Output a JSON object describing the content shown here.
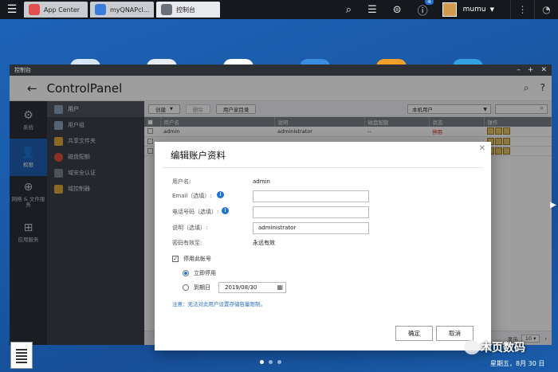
{
  "taskbar": {
    "tabs": [
      {
        "label": "App Center",
        "color": "#e34f4f"
      },
      {
        "label": "myQNAPcl...",
        "color": "#3a7dd8"
      },
      {
        "label": "控制台",
        "color": "#6b7078"
      }
    ],
    "notification_count": "4",
    "username": "mumu"
  },
  "controlpanel": {
    "window_title": "控制台",
    "title": "ControlPanel",
    "rail": [
      {
        "label": "系统",
        "icon": "gear-icon"
      },
      {
        "label": "权限",
        "icon": "user-icon"
      },
      {
        "label": "网络 & 文件服务",
        "icon": "globe-icon"
      },
      {
        "label": "应用服务",
        "icon": "apps-icon"
      }
    ],
    "subnav": [
      {
        "label": "用户",
        "color": "#8ea0b8"
      },
      {
        "label": "用户组",
        "color": "#8ea0b8"
      },
      {
        "label": "共享文件夹",
        "color": "#e0a83a"
      },
      {
        "label": "磁盘配额",
        "color": "#e04e3a"
      },
      {
        "label": "域安全认证",
        "color": "#7d8794"
      },
      {
        "label": "域控制器",
        "color": "#e0a83a"
      }
    ],
    "toolbar": {
      "create": "创建",
      "delete": "删除",
      "home": "用户家目录",
      "filter": "本机用户"
    },
    "table": {
      "headers": [
        "用户名",
        "说明",
        "磁盘配额",
        "状态",
        "操作"
      ],
      "rows": [
        {
          "name": "admin",
          "desc": "administrator",
          "quota": "--",
          "status": "停用"
        }
      ]
    },
    "pager": {
      "label": "显示",
      "size": "10"
    }
  },
  "dialog": {
    "title": "编辑账户资料",
    "username_label": "用户名:",
    "username_value": "admin",
    "email_label": "Email（选填）:",
    "email_value": "",
    "phone_label": "电话号码（选填）:",
    "phone_value": "",
    "desc_label": "说明（选填）:",
    "desc_value": "administrator",
    "pw_label": "密码有效至:",
    "pw_value": "永远有效",
    "disable_label": "停用此帐号",
    "now_label": "立即停用",
    "expire_label": "到期日",
    "expire_date": "2019/08/30",
    "note": "注意：无法对此用户设置存储容量限制。",
    "ok": "确定",
    "cancel": "取消"
  },
  "desktop": {
    "watermark": "木页数码",
    "clock": "星期五，8月 30 日"
  }
}
